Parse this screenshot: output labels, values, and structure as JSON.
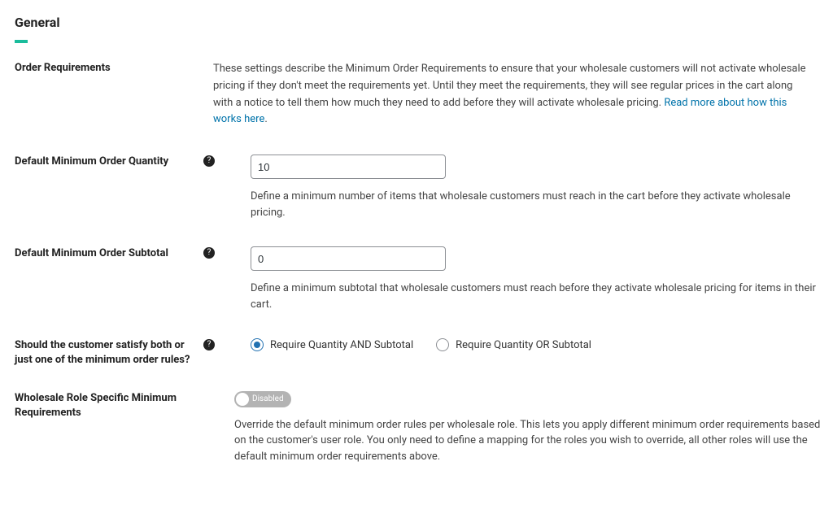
{
  "header": {
    "title": "General"
  },
  "sections": {
    "order_requirements": {
      "label": "Order Requirements",
      "description_pre": "These settings describe the Minimum Order Requirements to ensure that your wholesale customers will not activate wholesale pricing if they don't meet the requirements yet. Until they meet the requirements, they will see regular prices in the cart along with a notice to tell them how much they need to add before they will activate wholesale pricing. ",
      "link_text": "Read more about how this works here",
      "description_post": "."
    },
    "min_order_qty": {
      "label": "Default Minimum Order Quantity",
      "value": "10",
      "help": "Define a minimum number of items that wholesale customers must reach in the cart before they activate wholesale pricing."
    },
    "min_order_subtotal": {
      "label": "Default Minimum Order Subtotal",
      "value": "0",
      "help": "Define a minimum subtotal that wholesale customers must reach before they activate wholesale pricing for items in their cart."
    },
    "satisfy_rule": {
      "label": "Should the customer satisfy both or just one of the minimum order rules?",
      "options": {
        "and": "Require Quantity AND Subtotal",
        "or": "Require Quantity OR Subtotal"
      },
      "selected": "and"
    },
    "role_specific": {
      "label": "Wholesale Role Specific Minimum Requirements",
      "toggle_state": "Disabled",
      "help": "Override the default minimum order rules per wholesale role. This lets you apply different minimum order requirements based on the customer's user role. You only need to define a mapping for the roles you wish to override, all other roles will use the default minimum order requirements above."
    }
  }
}
